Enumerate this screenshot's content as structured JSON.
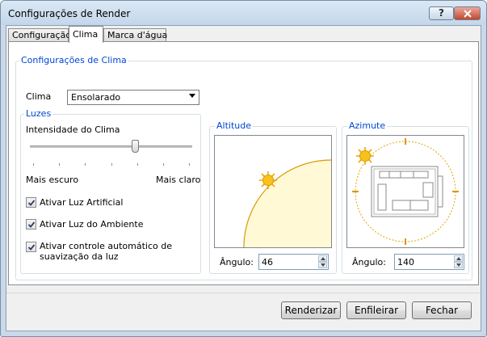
{
  "window": {
    "title": "Configurações de Render",
    "help_label": "?"
  },
  "tabs": [
    {
      "label": "Configuração",
      "active": false
    },
    {
      "label": "Clima",
      "active": true
    },
    {
      "label": "Marca d'água",
      "active": false
    }
  ],
  "climate_settings": {
    "legend": "Configurações de Clima",
    "climate_label": "Clima",
    "climate_value": "Ensolarado"
  },
  "lights": {
    "legend": "Luzes",
    "intensity_label": "Intensidade do Clima",
    "intensity_value": 0.65,
    "min_label": "Mais escuro",
    "max_label": "Mais claro",
    "artificial_light": {
      "label": "Ativar Luz Artificial",
      "checked": true
    },
    "ambient_light": {
      "label": "Ativar Luz do Ambiente",
      "checked": true
    },
    "auto_smoothing": {
      "line1": "Ativar controle automático de",
      "line2": "suavização da luz",
      "checked": true
    }
  },
  "altitude": {
    "legend": "Altitude",
    "angle_label": "Ângulo:",
    "angle_value": "46"
  },
  "azimuth": {
    "legend": "Azimute",
    "angle_label": "Ângulo:",
    "angle_value": "140"
  },
  "footer": {
    "render_label": "Renderizar",
    "queue_label": "Enfileirar",
    "close_label": "Fechar"
  },
  "colors": {
    "legend_blue": "#0046d5",
    "sun_yellow": "#f7c21a",
    "arc_orange": "#d89a00",
    "sky_fill": "#fff9d6"
  }
}
